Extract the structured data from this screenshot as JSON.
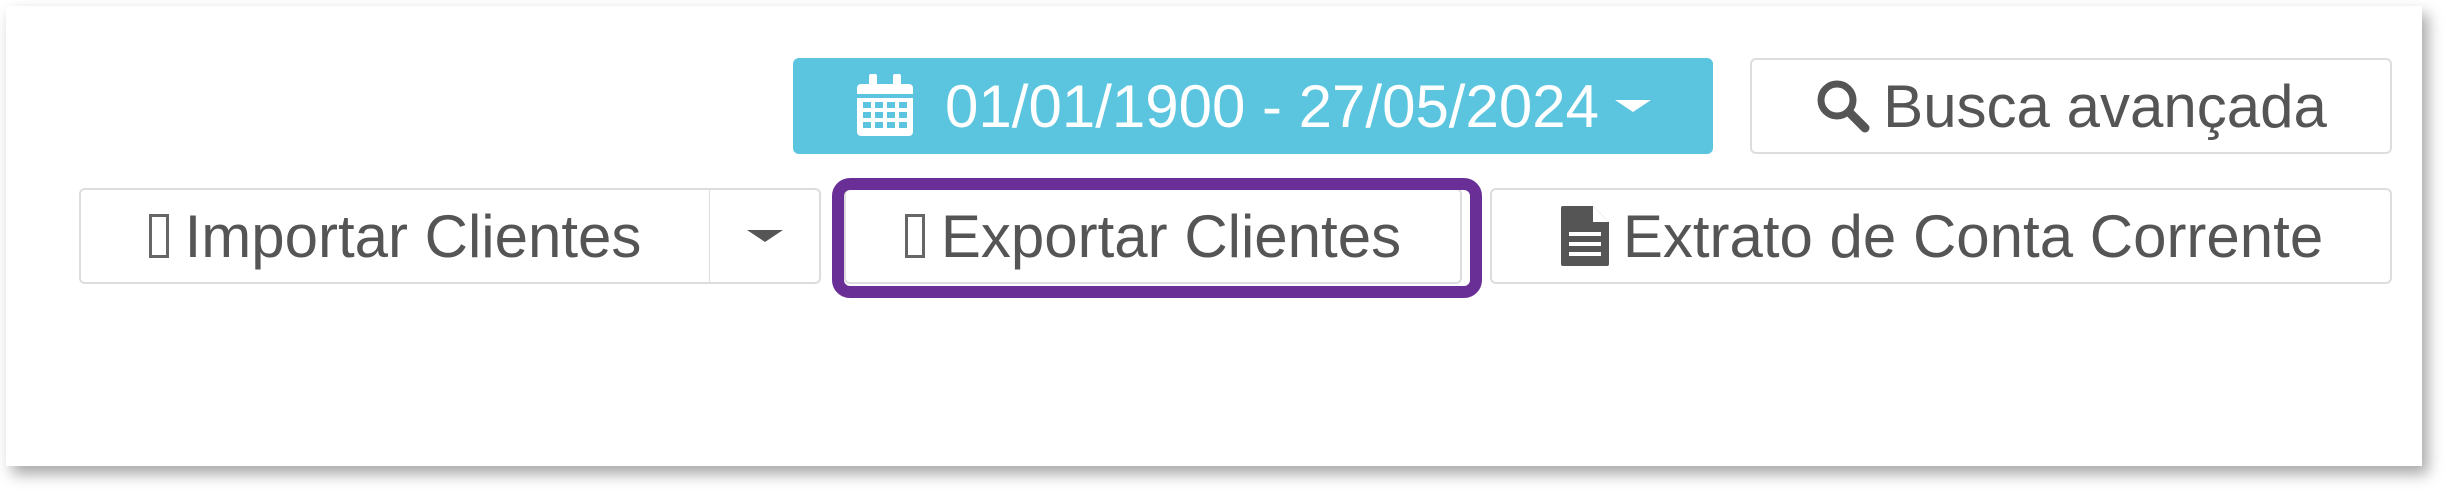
{
  "date_range": {
    "label": "01/01/1900 - 27/05/2024",
    "icon": "calendar-icon",
    "color": "#5bc5df"
  },
  "advanced_search": {
    "label": "Busca avançada",
    "icon": "search-icon"
  },
  "import_clients": {
    "label": "Importar Clientes",
    "icon": "missing-glyph",
    "dropdown_icon": "caret-down-icon"
  },
  "export_clients": {
    "label": "Exportar Clientes",
    "icon": "missing-glyph"
  },
  "highlight": {
    "color": "#6a2f96",
    "target": "export-clients-button"
  },
  "account_statement": {
    "label": "Extrato de Conta Corrente",
    "icon": "file-text-icon"
  }
}
